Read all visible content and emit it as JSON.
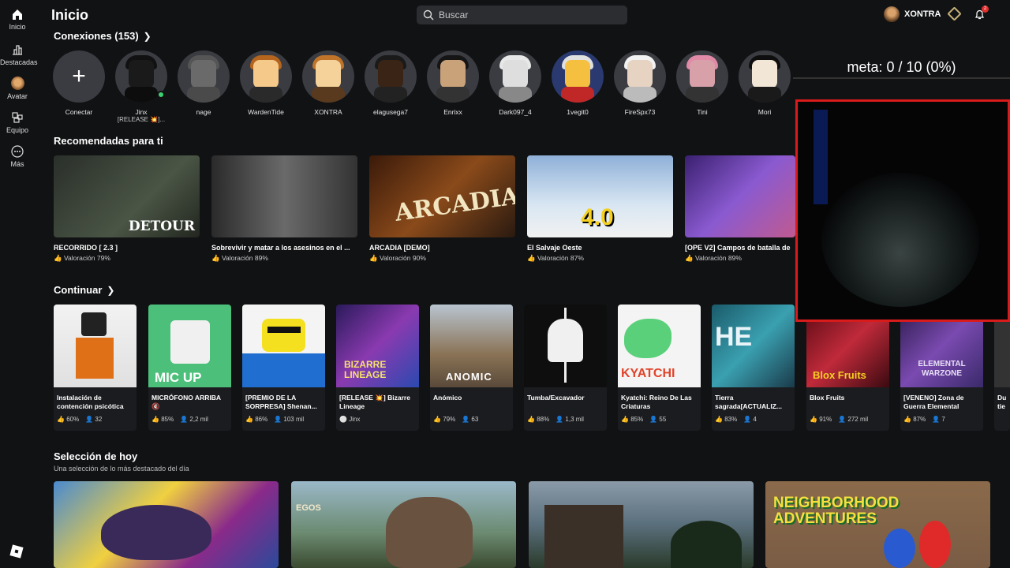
{
  "sidebar": {
    "items": [
      {
        "label": "Inicio",
        "icon": "home-icon"
      },
      {
        "label": "Destacadas",
        "icon": "chart-icon"
      },
      {
        "label": "Avatar",
        "icon": "avatar-icon"
      },
      {
        "label": "Equipo",
        "icon": "group-icon"
      },
      {
        "label": "Más",
        "icon": "more-icon"
      }
    ]
  },
  "header": {
    "title": "Inicio",
    "search_placeholder": "Buscar",
    "username": "XONTRA",
    "notification_count": "2"
  },
  "connections": {
    "title": "Conexiones (153)",
    "items": [
      {
        "name": "Conectar",
        "sub": ""
      },
      {
        "name": "Jinx",
        "sub": "[RELEASE 💥]..."
      },
      {
        "name": "nage",
        "sub": ""
      },
      {
        "name": "WardenTide",
        "sub": ""
      },
      {
        "name": "XONTRA",
        "sub": ""
      },
      {
        "name": "elagusega7",
        "sub": ""
      },
      {
        "name": "Enrixx",
        "sub": ""
      },
      {
        "name": "Dark097_4",
        "sub": ""
      },
      {
        "name": "1vegit0",
        "sub": ""
      },
      {
        "name": "FireSpx73",
        "sub": ""
      },
      {
        "name": "Tini",
        "sub": ""
      },
      {
        "name": "Mori",
        "sub": ""
      }
    ]
  },
  "recommended": {
    "title": "Recomendadas para ti",
    "items": [
      {
        "title": "RECORRIDO [ 2.3 ]",
        "rating": "Valoración 79%",
        "thumb_text": "DETOUR",
        "color": "#3b4536"
      },
      {
        "title": "Sobrevivir y matar a los asesinos en el ...",
        "rating": "Valoración 89%",
        "thumb_text": "",
        "color": "#4a4a4a"
      },
      {
        "title": "ARCADIA [DEMO]",
        "rating": "Valoración 90%",
        "thumb_text": "ARCADIA",
        "color": "#4a2c18"
      },
      {
        "title": "El Salvaje Oeste",
        "rating": "Valoración 87%",
        "thumb_text": "4.0",
        "color": "#6f8db0"
      },
      {
        "title": "[OPE V2] Campos de batalla de",
        "rating": "Valoración 89%",
        "thumb_text": "",
        "color": "#4b2e7a"
      }
    ]
  },
  "continue": {
    "title": "Continuar",
    "items": [
      {
        "title": "Instalación de contención psicótica",
        "rating": "60%",
        "players": "32",
        "thumb_text": "",
        "color": "#f0f0f0"
      },
      {
        "title": "MICRÓFONO ARRIBA 🔇",
        "rating": "85%",
        "players": "2,2 mil",
        "thumb_text": "MIC UP",
        "color": "#3fb86b"
      },
      {
        "title": "[PREMIO DE LA SORPRESA] Shenan...",
        "rating": "86%",
        "players": "103 mil",
        "thumb_text": "",
        "color": "#f7f7f7"
      },
      {
        "title": "[RELEASE 💥] Bizarre Lineage",
        "rating": "",
        "players": "Jinx",
        "thumb_text": "BIZARRE LINEAGE",
        "color": "#5a2a8c"
      },
      {
        "title": "Anómico",
        "rating": "79%",
        "players": "63",
        "thumb_text": "ANOMIC",
        "color": "#8a7356"
      },
      {
        "title": "Tumba/Excavador",
        "rating": "88%",
        "players": "1,3 mil",
        "thumb_text": "",
        "color": "#0e0e0e"
      },
      {
        "title": "Kyatchi: Reino De Las Criaturas",
        "rating": "85%",
        "players": "55",
        "thumb_text": "KYATCHI",
        "color": "#f2f2f2"
      },
      {
        "title": "Tierra sagrada[ACTUALIZ...",
        "rating": "83%",
        "players": "4",
        "thumb_text": "HE",
        "color": "#2d8a9a"
      },
      {
        "title": "Blox Fruits",
        "rating": "91%",
        "players": "272 mil",
        "thumb_text": "Blox Fruits",
        "color": "#b3202a"
      },
      {
        "title": "[VENENO] Zona de Guerra Elemental",
        "rating": "87%",
        "players": "7",
        "thumb_text": "ELEMENTAL WARZONE",
        "color": "#6a3a9a"
      },
      {
        "title": "Du tie",
        "rating": "",
        "players": "",
        "thumb_text": "",
        "color": "#333"
      }
    ]
  },
  "today": {
    "title": "Selección de hoy",
    "subtitle": "Una selección de lo más destacado del día",
    "items": [
      {
        "thumb_text": "",
        "color": "#2a6ab0"
      },
      {
        "thumb_text": "EGOS",
        "color": "#6b8a70"
      },
      {
        "thumb_text": "",
        "color": "#5a6f7c"
      },
      {
        "thumb_text": "NEIGHBORHOOD ADVENTURES",
        "color": "#7a5c45"
      }
    ]
  },
  "overlay": {
    "meta_text": "meta:  0 / 10 (0%)"
  }
}
